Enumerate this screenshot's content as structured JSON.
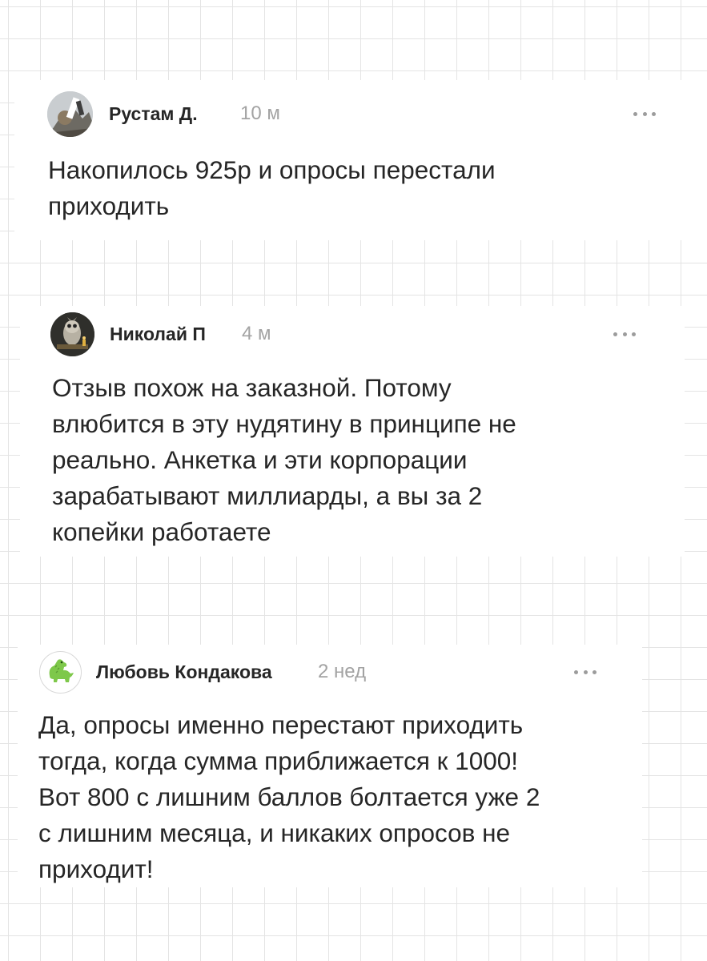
{
  "comments": [
    {
      "author": "Рустам Д.",
      "time": "10 м",
      "text": "Накопилось 925р и опросы перестали\nприходить",
      "avatar_icon": "user-photo-avatar",
      "more_icon": "more-horizontal-icon"
    },
    {
      "author": "Николай П",
      "time": "4 м",
      "text": "Отзыв похож на заказной. Потому\nвлюбится в эту нудятину в принципе не\nреально. Анкетка и эти корпорации\nзарабатывают миллиарды, а вы за 2\nкопейки работаете",
      "avatar_icon": "owl-photo-avatar",
      "more_icon": "more-horizontal-icon"
    },
    {
      "author": "Любовь Кондакова",
      "time": "2 нед",
      "text": "Да, опросы именно перестают приходить\nтогда, когда сумма приближается к 1000!\nВот 800 с лишним баллов болтается уже 2\nс лишним месяца, и никаких опросов не\nприходит!",
      "avatar_icon": "dinosaur-avatar",
      "more_icon": "more-horizontal-icon"
    }
  ],
  "colors": {
    "page_background": "#ffffff",
    "grid_lines": "#e4e4e4",
    "text": "#262626",
    "muted": "#a3a3a3",
    "dino_green": "#7ec84a"
  }
}
